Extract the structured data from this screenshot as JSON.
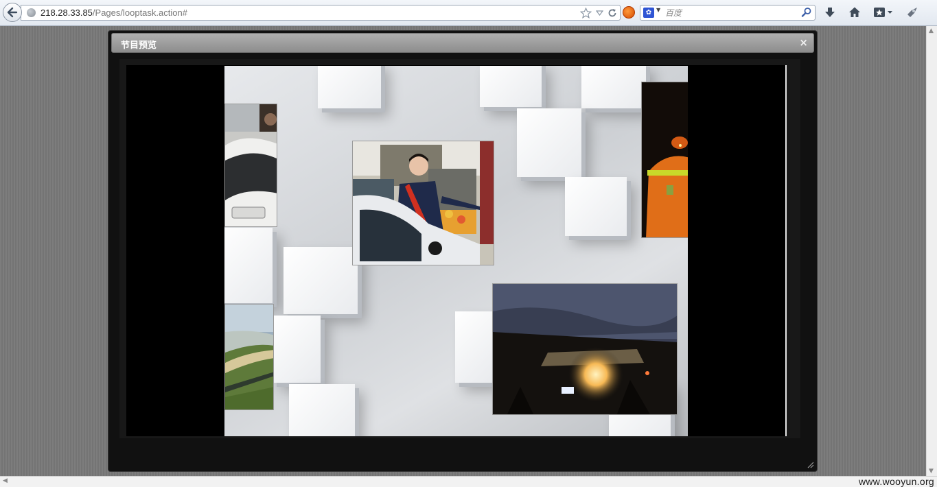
{
  "browser": {
    "url_host": "218.28.33.85",
    "url_path": "/Pages/looptask.action#",
    "search_placeholder": "百度",
    "search_engine_icon": "baidu-paw-icon"
  },
  "modal": {
    "title": "节目预览",
    "close_label": "×"
  },
  "preview": {
    "photos": [
      {
        "name": "photo-car-left",
        "subject": "car"
      },
      {
        "name": "photo-attendant",
        "subject": "attendant with sash"
      },
      {
        "name": "photo-worker-orange",
        "subject": "worker in orange vest"
      },
      {
        "name": "photo-aerial-river",
        "subject": "aerial river view"
      },
      {
        "name": "photo-night-tunnel",
        "subject": "night scene"
      }
    ]
  },
  "watermark": "www.wooyun.org",
  "colors": {
    "toolbar_bg": "#e8edf3",
    "modal_header": "#9a9a9a",
    "modal_body": "#111111",
    "page_bg": "#7a7a7a"
  }
}
